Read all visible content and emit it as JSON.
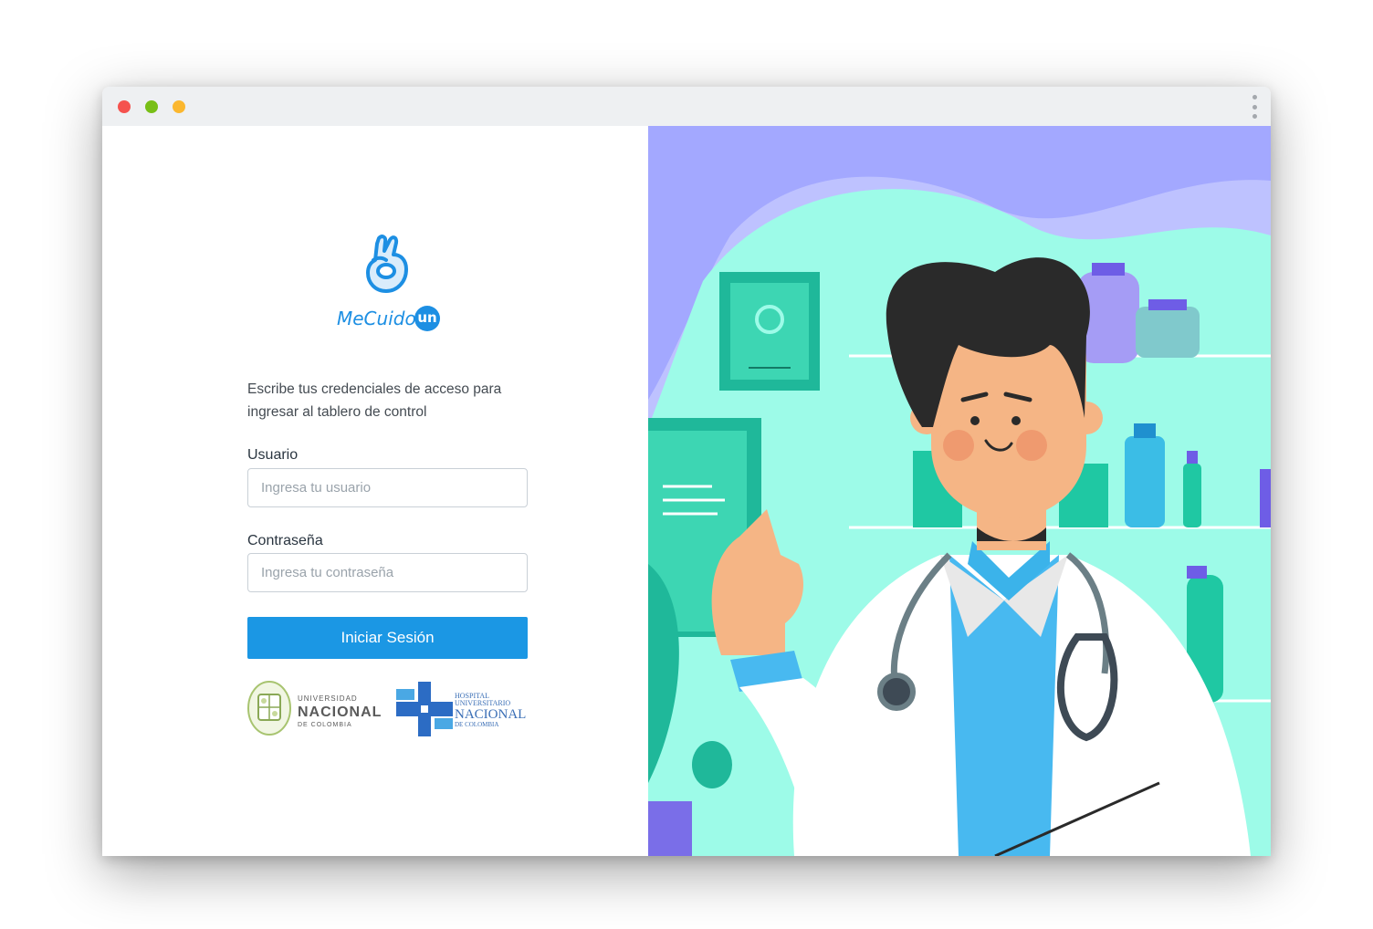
{
  "window": {
    "traffic_lights": {
      "red": "#f5524e",
      "green": "#78bf17",
      "yellow": "#fbb72f"
    },
    "menu_icon": "kebab-menu-icon"
  },
  "brand": {
    "name": "MeCuido",
    "badge": "un",
    "color": "#1d8fe3",
    "icon": "ok-hand-icon"
  },
  "login": {
    "intro": "Escribe tus credenciales de acceso para ingresar al tablero de control",
    "username": {
      "label": "Usuario",
      "placeholder": "Ingresa tu usuario",
      "value": ""
    },
    "password": {
      "label": "Contraseña",
      "placeholder": "Ingresa tu contraseña",
      "value": ""
    },
    "submit_label": "Iniciar Sesión",
    "button_color": "#1b97e4"
  },
  "partners": {
    "university": {
      "line1": "UNIVERSIDAD",
      "line2": "NACIONAL",
      "line3": "DE COLOMBIA",
      "icon": "university-seal-icon"
    },
    "hospital": {
      "line1": "HOSPITAL",
      "line2": "UNIVERSITARIO",
      "line3": "NACIONAL",
      "line4": "DE COLOMBIA",
      "icon": "hospital-cross-icon"
    }
  },
  "illustration": {
    "subject": "doctor-illustration",
    "colors": {
      "background": "#a3a8ff",
      "mint": "#9dfbe8",
      "teal": "#1fc8a3",
      "skin": "#f5b585",
      "hair": "#2a2a2a",
      "shirt": "#48b9f0"
    }
  }
}
